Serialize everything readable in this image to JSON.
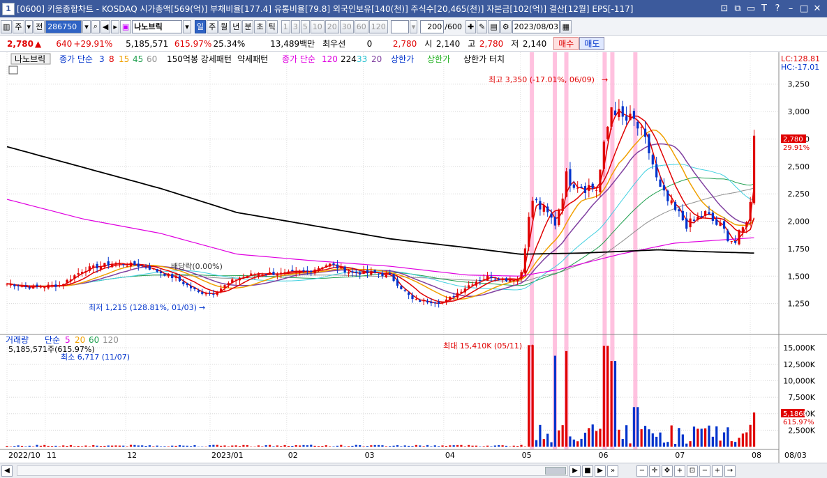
{
  "window": {
    "num": "1",
    "title": "[0600] 키움종합차트 - KOSDAQ 시가총액[569(억)] 부채비율[177.4] 유통비율[79.8] 외국인보유[140(천)] 주식수[20,465(천)] 자본금[102(억)] 결산[12월] EPS[-117]",
    "buttons": [
      "⊡",
      "⧉",
      "▭",
      "T",
      "?",
      "–",
      "□",
      "✕"
    ]
  },
  "toolbar": {
    "type_main": "주",
    "type_all": "전",
    "code": "286750",
    "stock_name": "나노브릭",
    "periods": [
      "일",
      "주",
      "월",
      "년",
      "분",
      "초",
      "틱"
    ],
    "minutes": [
      "1",
      "3",
      "5",
      "10",
      "20",
      "30",
      "60",
      "120"
    ],
    "count": "200",
    "count_total": "/600",
    "date": "2023/08/03"
  },
  "quote": {
    "price": "2,780",
    "change": "640",
    "change_pct": "+29.91%",
    "volume": "5,185,571",
    "volume_ratio": "615.97%",
    "turnover": "25.34%",
    "amount": "13,489백만",
    "priority_label": "최우선",
    "priority_qty": "0",
    "ask_price": "2,780",
    "open_label": "시",
    "open": "2,140",
    "high_label": "고",
    "high": "2,780",
    "low_label": "저",
    "low": "2,140",
    "buy_label": "매수",
    "sell_label": "매도"
  },
  "legend": {
    "stock": "나노브릭",
    "ma_title": "종가 단순",
    "ma_periods": [
      "3",
      "8",
      "15",
      "45",
      "60"
    ],
    "pattern1": "150억봉 강세패턴",
    "pattern2": "약세패턴",
    "ma2_title": "종가 단순",
    "ma2_periods": [
      "120",
      "224",
      "33",
      "20"
    ],
    "limit1": "상한가",
    "limit2": "상한가",
    "limit3": "상한가 터치",
    "lc": "LC:128.81",
    "hc": "HC:-17.01"
  },
  "annotations": {
    "high": "최고 3,350 (-17.01%, 06/09)",
    "low": "최저 1,215 (128.81%, 01/03)",
    "ex_div": "배당락(0.00%)",
    "vol_max": "최대 15,410K (05/11)",
    "vol_min": "최소 6,717 (11/07)",
    "price_tag": "2,780",
    "price_tag_pct": "29.91%",
    "vol_tag": "5,186K",
    "vol_tag_pct": "615.97%"
  },
  "volume_legend": {
    "title": "거래량",
    "ma_title": "단순",
    "periods": [
      "5",
      "20",
      "60",
      "120"
    ],
    "current": "5,185,571주(615.97%)"
  },
  "colors": {
    "accent": "#2f63c4",
    "up": "#e00000",
    "down": "#0033cc",
    "ma3": "#e00000",
    "ma8": "#e00000",
    "ma15": "#f0a000",
    "ma45": "#20a050",
    "ma60": "#909090",
    "ma120": "#e000e0",
    "ma224": "#000000",
    "ma33": "#40d0e0",
    "ma20": "#8040a0",
    "limit_band": "#ffb6d9"
  },
  "chart_data": {
    "type": "candlestick",
    "price_axis": [
      "3,250",
      "3,000",
      "2,750",
      "2,500",
      "2,250",
      "2,000",
      "1,750",
      "1,500",
      "1,250"
    ],
    "price_ticks": [
      3250,
      3000,
      2750,
      2500,
      2250,
      2000,
      1750,
      1500,
      1250
    ],
    "price_range": [
      1000,
      3350
    ],
    "volume_axis": [
      "15,000K",
      "12,500K",
      "10,000K",
      "7,500K",
      "5,000K",
      "2,500K"
    ],
    "volume_ticks": [
      15000,
      12500,
      10000,
      7500,
      5000,
      2500
    ],
    "volume_range": [
      0,
      16500
    ],
    "x_labels": [
      "2022/10",
      "11",
      "12",
      "2023/01",
      "02",
      "03",
      "04",
      "05",
      "06",
      "07",
      "08",
      "08/03"
    ],
    "x_label_fracs": [
      0.0,
      0.05,
      0.155,
      0.265,
      0.365,
      0.465,
      0.57,
      0.67,
      0.77,
      0.87,
      0.97,
      1.03
    ],
    "limit_up_fracs": [
      0.685,
      0.715,
      0.73,
      0.78,
      0.79,
      0.82
    ],
    "close_anchors": [
      [
        0,
        1430
      ],
      [
        0.03,
        1400
      ],
      [
        0.07,
        1420
      ],
      [
        0.1,
        1560
      ],
      [
        0.14,
        1620
      ],
      [
        0.18,
        1590
      ],
      [
        0.22,
        1480
      ],
      [
        0.25,
        1350
      ],
      [
        0.27,
        1350
      ],
      [
        0.3,
        1480
      ],
      [
        0.33,
        1530
      ],
      [
        0.36,
        1520
      ],
      [
        0.39,
        1540
      ],
      [
        0.42,
        1610
      ],
      [
        0.45,
        1530
      ],
      [
        0.48,
        1530
      ],
      [
        0.5,
        1500
      ],
      [
        0.53,
        1280
      ],
      [
        0.55,
        1270
      ],
      [
        0.57,
        1260
      ],
      [
        0.59,
        1360
      ],
      [
        0.61,
        1450
      ],
      [
        0.63,
        1500
      ],
      [
        0.65,
        1470
      ],
      [
        0.67,
        1480
      ],
      [
        0.685,
        2200
      ],
      [
        0.7,
        2100
      ],
      [
        0.715,
        1980
      ],
      [
        0.73,
        2400
      ],
      [
        0.75,
        2330
      ],
      [
        0.77,
        2300
      ],
      [
        0.78,
        2700
      ],
      [
        0.79,
        3100
      ],
      [
        0.8,
        2930
      ],
      [
        0.82,
        2900
      ],
      [
        0.84,
        2600
      ],
      [
        0.85,
        2300
      ],
      [
        0.87,
        2100
      ],
      [
        0.89,
        1960
      ],
      [
        0.91,
        2070
      ],
      [
        0.93,
        1950
      ],
      [
        0.95,
        1800
      ],
      [
        0.96,
        1920
      ],
      [
        0.97,
        2140
      ],
      [
        0.975,
        2780
      ]
    ],
    "ma224_anchors": [
      [
        0,
        2680
      ],
      [
        0.1,
        2490
      ],
      [
        0.2,
        2300
      ],
      [
        0.3,
        2080
      ],
      [
        0.4,
        1960
      ],
      [
        0.5,
        1840
      ],
      [
        0.6,
        1760
      ],
      [
        0.67,
        1700
      ],
      [
        0.75,
        1710
      ],
      [
        0.85,
        1740
      ],
      [
        0.9,
        1725
      ],
      [
        0.975,
        1710
      ]
    ],
    "ma120_anchors": [
      [
        0,
        2200
      ],
      [
        0.1,
        2020
      ],
      [
        0.2,
        1890
      ],
      [
        0.3,
        1700
      ],
      [
        0.4,
        1640
      ],
      [
        0.5,
        1590
      ],
      [
        0.6,
        1510
      ],
      [
        0.67,
        1500
      ],
      [
        0.72,
        1560
      ],
      [
        0.8,
        1700
      ],
      [
        0.87,
        1800
      ],
      [
        0.975,
        1850
      ]
    ]
  }
}
